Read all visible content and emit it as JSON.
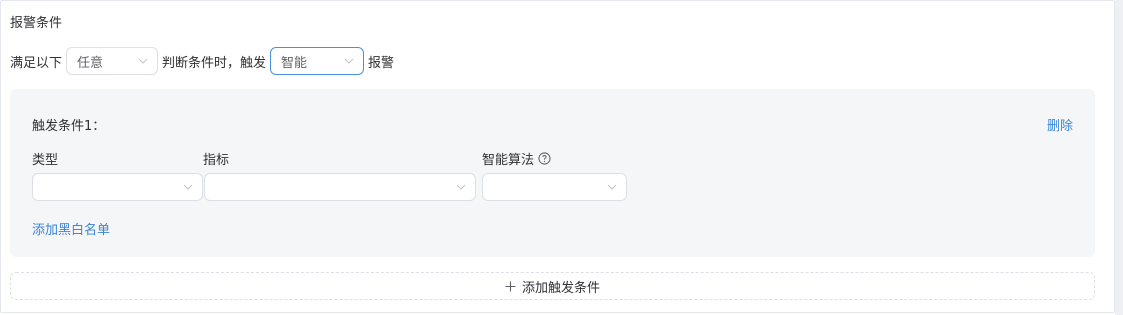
{
  "section": {
    "title": "报警条件"
  },
  "rule": {
    "prefix": "满足以下",
    "match_select": {
      "value": "任意"
    },
    "middle": "判断条件时，触发",
    "trigger_select": {
      "value": "智能"
    },
    "suffix": "报警"
  },
  "condition": {
    "title": "触发条件1：",
    "delete_label": "删除",
    "fields": {
      "type_label": "类型",
      "metric_label": "指标",
      "algorithm_label": "智能算法"
    },
    "blacklist_label": "添加黑白名单"
  },
  "add_trigger": {
    "label": "添加触发条件"
  },
  "icons": {
    "select_arrow": "chevron-down-icon",
    "help": "question-circle-icon",
    "add": "plus-icon"
  },
  "colors": {
    "link": "#3a86d8",
    "focus_border": "#4a90e2",
    "card_bg": "#f5f6f8"
  }
}
